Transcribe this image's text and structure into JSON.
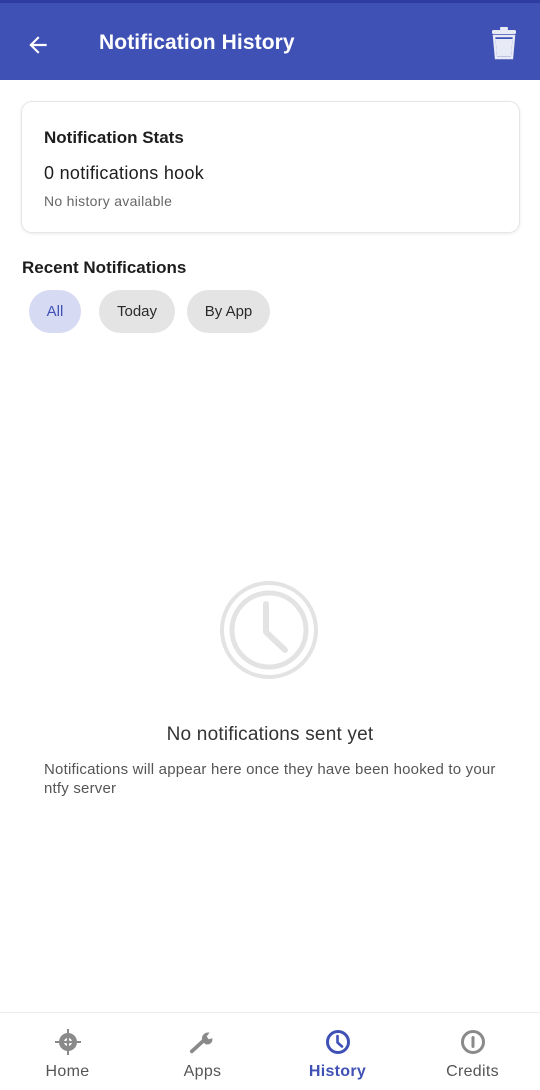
{
  "app_bar": {
    "title": "Notification History",
    "back_icon": "arrow-left-icon",
    "trash_icon": "trash-icon",
    "color": "#3f51b5"
  },
  "stats": {
    "title": "Notification Stats",
    "count_text": "0 notifications hook",
    "subtitle": "No history available"
  },
  "recent": {
    "title": "Recent Notifications",
    "filters": [
      {
        "label": "All",
        "selected": true
      },
      {
        "label": "Today",
        "selected": false
      },
      {
        "label": "By App",
        "selected": false
      }
    ]
  },
  "empty_state": {
    "icon": "clock-icon",
    "title": "No notifications sent yet",
    "description": "Notifications will appear here once they have been hooked to your ntfy server"
  },
  "bottom_nav": {
    "items": [
      {
        "label": "Home",
        "icon": "crosshair-icon",
        "active": false
      },
      {
        "label": "Apps",
        "icon": "wrench-icon",
        "active": false
      },
      {
        "label": "History",
        "icon": "clock-icon",
        "active": true
      },
      {
        "label": "Credits",
        "icon": "info-icon",
        "active": false
      }
    ],
    "active_color": "#3f51b5"
  }
}
